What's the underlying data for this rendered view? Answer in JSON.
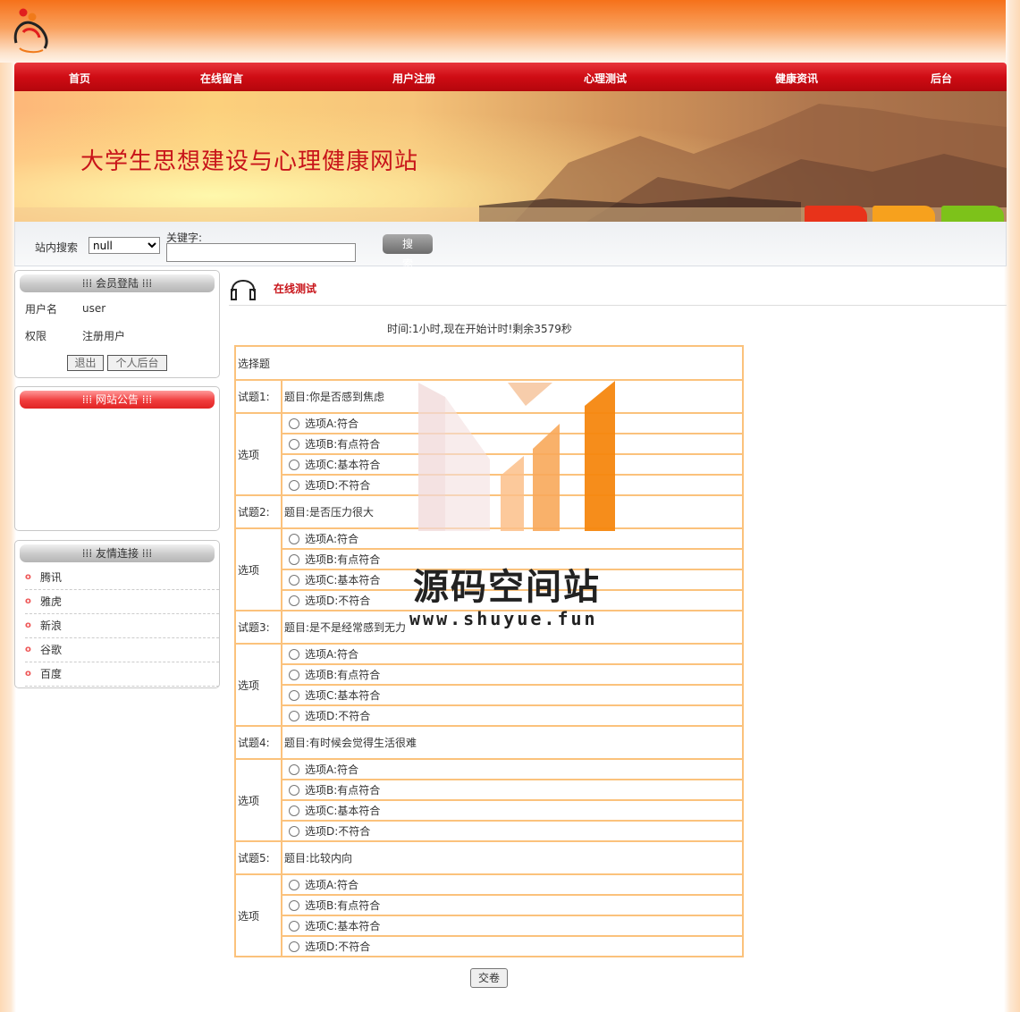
{
  "nav": [
    "首页",
    "在线留言",
    "用户注册",
    "心理测试",
    "健康资讯",
    "后台"
  ],
  "banner": {
    "title": "大学生思想建设与心理健康网站"
  },
  "search": {
    "label": "站内搜索",
    "select_value": "null",
    "keyword_label": "关键字:",
    "keyword_value": "",
    "button": "搜 索"
  },
  "login": {
    "title": "⁞⁞⁞ 会员登陆 ⁞⁞⁞",
    "username_label": "用户名",
    "username": "user",
    "role_label": "权限",
    "role": "注册用户",
    "logout": "退出",
    "profile": "个人后台"
  },
  "notice": {
    "title": "⁞⁞⁞ 网站公告 ⁞⁞⁞"
  },
  "links": {
    "title": "⁞⁞⁞ 友情连接 ⁞⁞⁞",
    "bullet": "o",
    "items": [
      "腾讯",
      "雅虎",
      "新浪",
      "谷歌",
      "百度"
    ]
  },
  "content": {
    "title": "在线测试",
    "timer": "时间:1小时,现在开始计时!剩余3579秒",
    "section": "选择题",
    "option_label": "选项",
    "questions": [
      {
        "no": "试题1:",
        "title": "题目:你是否感到焦虑"
      },
      {
        "no": "试题2:",
        "title": "题目:是否压力很大"
      },
      {
        "no": "试题3:",
        "title": "题目:是不是经常感到无力"
      },
      {
        "no": "试题4:",
        "title": "题目:有时候会觉得生活很难"
      },
      {
        "no": "试题5:",
        "title": "题目:比较内向"
      }
    ],
    "options": [
      "选项A:符合",
      "选项B:有点符合",
      "选项C:基本符合",
      "选项D:不符合"
    ],
    "submit": "交卷"
  },
  "watermark": {
    "line1": "源码空间站",
    "line2": "www.shuyue.fun"
  },
  "colors": {
    "nav": "#cf0c14",
    "table_border": "#fbc27c",
    "accent": "#c8141a",
    "header": "#f6711a"
  }
}
